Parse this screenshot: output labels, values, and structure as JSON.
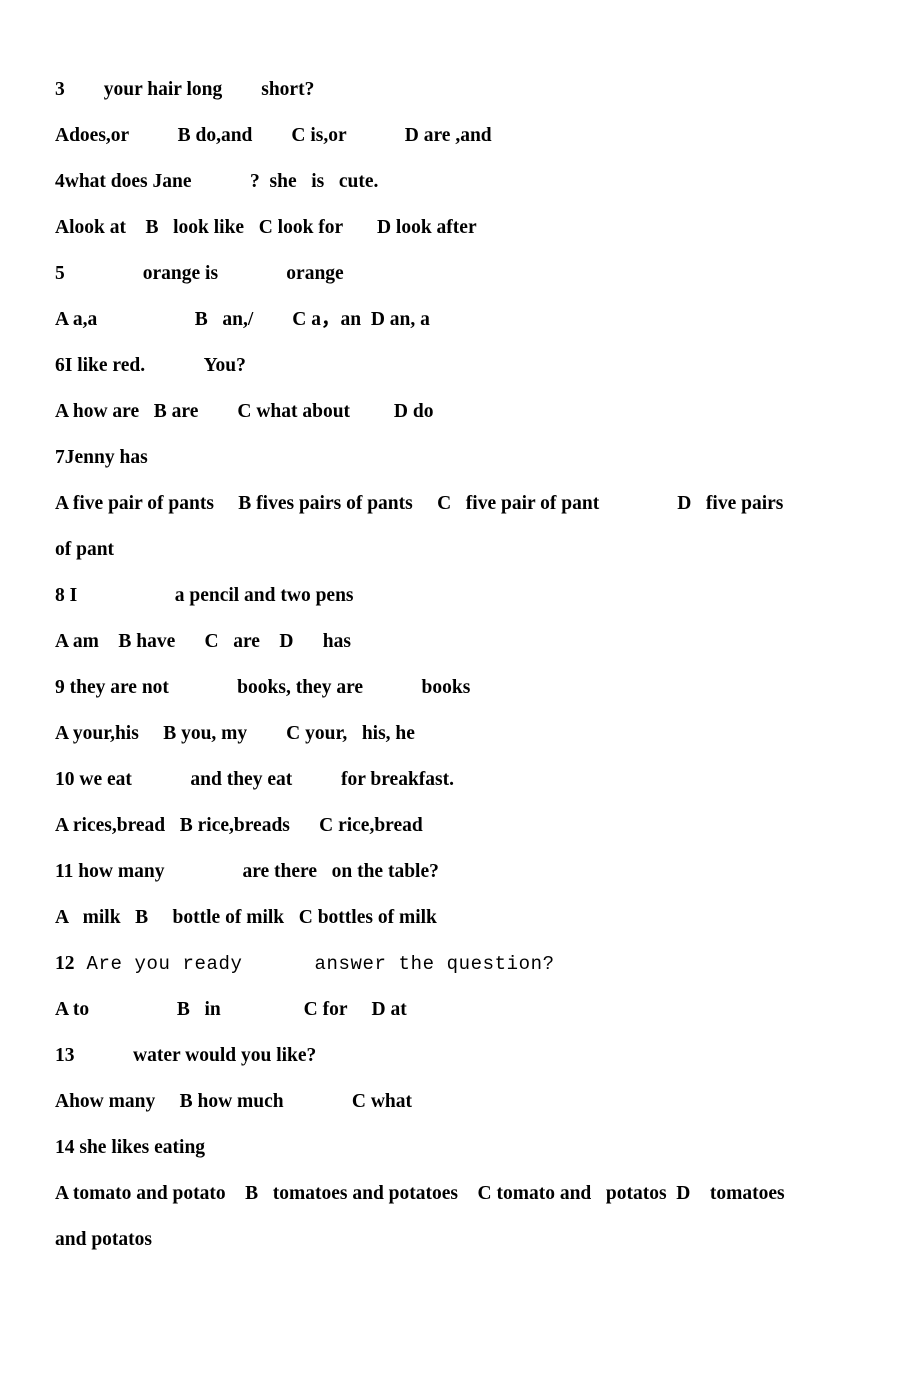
{
  "document": {
    "type": "worksheet",
    "subject": "English grammar multiple choice",
    "background_color": "#ffffff",
    "text_color": "#000000"
  },
  "lines": [
    {
      "id": "q3-stem",
      "kind": "question",
      "number": "3",
      "text": "3____your hair long____short?"
    },
    {
      "id": "q3-options",
      "kind": "options",
      "text": "Adoes,or          B do,and        C is,or            D are ,and"
    },
    {
      "id": "q4-stem",
      "kind": "question",
      "number": "4",
      "text": "4what does Jane  _____?  she   is   cute."
    },
    {
      "id": "q4-options",
      "kind": "options",
      "text": "Alook at    B   look like   C look for       D look after"
    },
    {
      "id": "q5-stem",
      "kind": "question",
      "number": "5",
      "text": "5_______  orange is______  orange"
    },
    {
      "id": "q5-options",
      "kind": "options",
      "text": "A a,a                    B   an,/        C a，an  D an, a"
    },
    {
      "id": "q6-stem",
      "kind": "question",
      "number": "6",
      "text": "6I like red.  _____You?"
    },
    {
      "id": "q6-options",
      "kind": "options",
      "text": "A how are   B are        C what about         D do"
    },
    {
      "id": "q7-stem",
      "kind": "question",
      "number": "7",
      "text": "7Jenny has  ______"
    },
    {
      "id": "q7-options",
      "kind": "options",
      "text": "A five pair of pants     B fives pairs of pants     C   five pair of pant                D   five pairs"
    },
    {
      "id": "q7-options-cont",
      "kind": "options-continued",
      "text": "of pant"
    },
    {
      "id": "q8-stem",
      "kind": "question",
      "number": "8",
      "text": "8 I  ________  a pencil and two pens"
    },
    {
      "id": "q8-options",
      "kind": "options",
      "text": "A am    B have      C   are    D      has"
    },
    {
      "id": "q9-stem",
      "kind": "question",
      "number": "9",
      "text": "9 they are not______  books, they are_____  books"
    },
    {
      "id": "q9-options",
      "kind": "options",
      "text": "A your,his     B you, my        C your,   his, he"
    },
    {
      "id": "q10-stem",
      "kind": "question",
      "number": "10",
      "text": "10 we eat  _____and they eat  ____for breakfast."
    },
    {
      "id": "q10-options",
      "kind": "options",
      "text": "A rices,bread   B rice,breads      C rice,bread"
    },
    {
      "id": "q11-stem",
      "kind": "question",
      "number": "11",
      "text": "11 how many  ______  are there   on the table?"
    },
    {
      "id": "q11-options",
      "kind": "options",
      "text": "A   milk   B     bottle of milk   C bottles of milk"
    },
    {
      "id": "q12-stem",
      "kind": "question",
      "number": "12",
      "text": "12 Are you ready ____ answer the question?",
      "font": "monospace"
    },
    {
      "id": "q12-options",
      "kind": "options",
      "text": "A to                  B   in                 C for     D at"
    },
    {
      "id": "q13-stem",
      "kind": "question",
      "number": "13",
      "text": "13 _____ water would you like?"
    },
    {
      "id": "q13-options",
      "kind": "options",
      "text": "Ahow many     B how much              C what"
    },
    {
      "id": "q14-stem",
      "kind": "question",
      "number": "14",
      "text": "14 she likes eating  ____"
    },
    {
      "id": "q14-options",
      "kind": "options",
      "text": "A tomato and potato    B   tomatoes and potatoes    C tomato and   potatos  D    tomatoes"
    },
    {
      "id": "q14-options-cont",
      "kind": "options-continued",
      "text": "and potatos"
    }
  ],
  "questions": [
    {
      "number": "3",
      "stem": "3____your hair long____short?",
      "blanks": 2,
      "options": [
        {
          "letter": "A",
          "text": "does,or"
        },
        {
          "letter": "B",
          "text": "do,and"
        },
        {
          "letter": "C",
          "text": "is,or"
        },
        {
          "letter": "D",
          "text": "are ,and"
        }
      ]
    },
    {
      "number": "4",
      "stem": "4what does Jane  _____?  she   is   cute.",
      "blanks": 1,
      "options": [
        {
          "letter": "A",
          "text": "look at"
        },
        {
          "letter": "B",
          "text": "look like"
        },
        {
          "letter": "C",
          "text": "look for"
        },
        {
          "letter": "D",
          "text": "look after"
        }
      ]
    },
    {
      "number": "5",
      "stem": "5_______  orange is______  orange",
      "blanks": 2,
      "options": [
        {
          "letter": "A",
          "text": "a,a"
        },
        {
          "letter": "B",
          "text": "an,/"
        },
        {
          "letter": "C",
          "text": "a，an"
        },
        {
          "letter": "D",
          "text": "an, a"
        }
      ]
    },
    {
      "number": "6",
      "stem": "6I like red.  _____You?",
      "blanks": 1,
      "options": [
        {
          "letter": "A",
          "text": "how are"
        },
        {
          "letter": "B",
          "text": "are"
        },
        {
          "letter": "C",
          "text": "what about"
        },
        {
          "letter": "D",
          "text": "do"
        }
      ]
    },
    {
      "number": "7",
      "stem": "7Jenny has  ______",
      "blanks": 1,
      "options": [
        {
          "letter": "A",
          "text": "five pair of pants"
        },
        {
          "letter": "B",
          "text": "fives pairs of pants"
        },
        {
          "letter": "C",
          "text": "five pair of pant"
        },
        {
          "letter": "D",
          "text": "five pairs of pant"
        }
      ]
    },
    {
      "number": "8",
      "stem": "8 I  ________  a pencil and two pens",
      "blanks": 1,
      "options": [
        {
          "letter": "A",
          "text": "am"
        },
        {
          "letter": "B",
          "text": "have"
        },
        {
          "letter": "C",
          "text": "are"
        },
        {
          "letter": "D",
          "text": "has"
        }
      ]
    },
    {
      "number": "9",
      "stem": "9 they are not______  books, they are_____  books",
      "blanks": 2,
      "options": [
        {
          "letter": "A",
          "text": "your,his"
        },
        {
          "letter": "B",
          "text": "you, my"
        },
        {
          "letter": "C",
          "text": "your,   his, he"
        }
      ]
    },
    {
      "number": "10",
      "stem": "10 we eat  _____and they eat  ____for breakfast.",
      "blanks": 2,
      "options": [
        {
          "letter": "A",
          "text": "rices,bread"
        },
        {
          "letter": "B",
          "text": "rice,breads"
        },
        {
          "letter": "C",
          "text": "rice,bread"
        }
      ]
    },
    {
      "number": "11",
      "stem": "11 how many  ______  are there   on the table?",
      "blanks": 1,
      "options": [
        {
          "letter": "A",
          "text": "milk"
        },
        {
          "letter": "B",
          "text": "bottle of milk"
        },
        {
          "letter": "C",
          "text": "bottles of milk"
        }
      ]
    },
    {
      "number": "12",
      "stem": "12 Are you ready ____ answer the question?",
      "blanks": 1,
      "font": "monospace",
      "options": [
        {
          "letter": "A",
          "text": "to"
        },
        {
          "letter": "B",
          "text": "in"
        },
        {
          "letter": "C",
          "text": "for"
        },
        {
          "letter": "D",
          "text": "at"
        }
      ]
    },
    {
      "number": "13",
      "stem": "13 _____ water would you like?",
      "blanks": 1,
      "options": [
        {
          "letter": "A",
          "text": "how many"
        },
        {
          "letter": "B",
          "text": "how much"
        },
        {
          "letter": "C",
          "text": "what"
        }
      ]
    },
    {
      "number": "14",
      "stem": "14 she likes eating  ____",
      "blanks": 1,
      "options": [
        {
          "letter": "A",
          "text": "tomato and potato"
        },
        {
          "letter": "B",
          "text": "tomatoes and potatoes"
        },
        {
          "letter": "C",
          "text": "tomato and   potatos"
        },
        {
          "letter": "D",
          "text": "tomatoes and potatos"
        }
      ]
    }
  ]
}
